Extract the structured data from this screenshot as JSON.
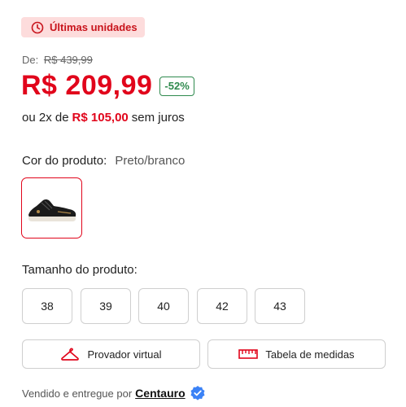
{
  "badge": {
    "label": "Últimas unidades",
    "icon": "clock-icon"
  },
  "pricing": {
    "from_label": "De:",
    "old_price": "R$ 439,99",
    "price": "R$ 209,99",
    "discount": "-52%",
    "installment_prefix": "ou 2x de",
    "installment_amount": "R$ 105,00",
    "installment_suffix": "sem juros"
  },
  "color": {
    "label": "Cor do produto:",
    "value": "Preto/branco"
  },
  "size": {
    "label": "Tamanho do produto:",
    "options": [
      "38",
      "39",
      "40",
      "42",
      "43"
    ]
  },
  "actions": {
    "virtual_fitting": "Provador virtual",
    "size_chart": "Tabela de medidas"
  },
  "seller": {
    "prefix": "Vendido e entregue por",
    "name": "Centauro"
  },
  "colors": {
    "accent_red": "#e1051b",
    "badge_bg": "#fddcdc",
    "discount_green": "#2f8a4e",
    "verified_blue": "#3b82f6"
  }
}
